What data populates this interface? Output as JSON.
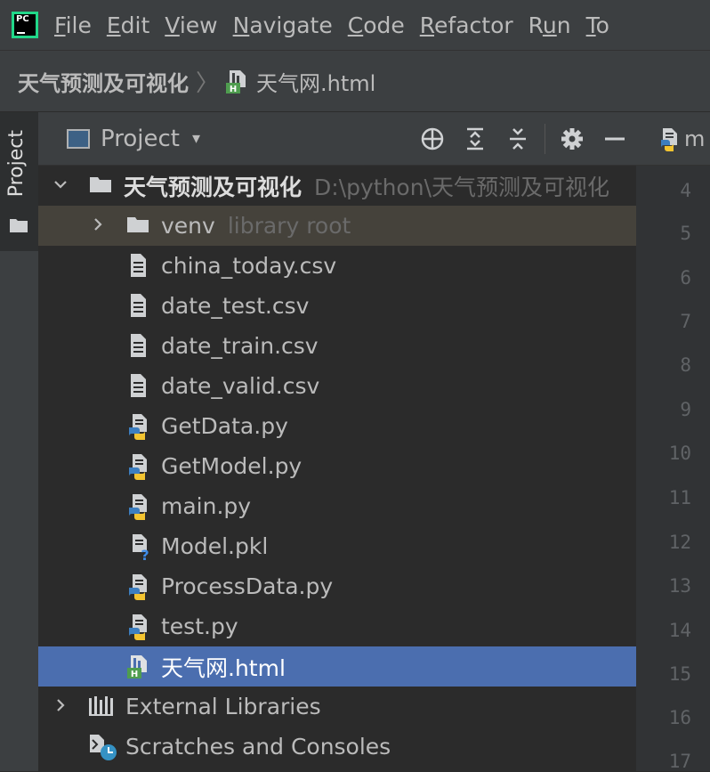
{
  "menubar": {
    "app_icon": "pycharm-logo",
    "items": [
      {
        "mnemonic": "F",
        "rest": "ile"
      },
      {
        "mnemonic": "E",
        "rest": "dit"
      },
      {
        "mnemonic": "V",
        "rest": "iew"
      },
      {
        "mnemonic": "N",
        "rest": "avigate"
      },
      {
        "mnemonic": "C",
        "rest": "ode"
      },
      {
        "mnemonic": "R",
        "rest": "efactor"
      },
      {
        "pre": "R",
        "mnemonic": "u",
        "rest": "n"
      },
      {
        "mnemonic": "T",
        "rest": "o"
      }
    ]
  },
  "breadcrumb": {
    "root": "天气预测及可视化",
    "separator": "〉",
    "file": "天气网.html",
    "file_icon": "html-file-icon"
  },
  "toolstrip": {
    "tab_label": "Project",
    "tab_icon": "folder-icon"
  },
  "project_panel": {
    "title": "Project",
    "caret": "▾",
    "tools": [
      "locate-icon",
      "expand-all-icon",
      "collapse-all-icon",
      "gear-icon",
      "hide-icon"
    ]
  },
  "editor": {
    "tab_label": "m",
    "tab_icon": "python-file-icon",
    "line_numbers": [
      "4",
      "5",
      "6",
      "7",
      "8",
      "9",
      "10",
      "11",
      "12",
      "13",
      "14",
      "15",
      "16",
      "17"
    ]
  },
  "tree": {
    "root": {
      "name": "天气预测及可视化",
      "path": "D:\\python\\天气预测及可视化",
      "icon": "folder-icon",
      "expanded": true
    },
    "venv": {
      "name": "venv",
      "hint": "library root",
      "icon": "folder-icon",
      "expanded": false
    },
    "files": [
      {
        "name": "china_today.csv",
        "icon": "text-file-icon"
      },
      {
        "name": "date_test.csv",
        "icon": "text-file-icon"
      },
      {
        "name": "date_train.csv",
        "icon": "text-file-icon"
      },
      {
        "name": "date_valid.csv",
        "icon": "text-file-icon"
      },
      {
        "name": "GetData.py",
        "icon": "python-file-icon"
      },
      {
        "name": "GetModel.py",
        "icon": "python-file-icon"
      },
      {
        "name": "main.py",
        "icon": "python-file-icon"
      },
      {
        "name": "Model.pkl",
        "icon": "unknown-file-icon"
      },
      {
        "name": "ProcessData.py",
        "icon": "python-file-icon"
      },
      {
        "name": "test.py",
        "icon": "python-file-icon"
      },
      {
        "name": "天气网.html",
        "icon": "html-file-icon",
        "selected": true
      }
    ],
    "external_libraries": {
      "name": "External Libraries",
      "icon": "library-icon"
    },
    "scratches": {
      "name": "Scratches and Consoles",
      "icon": "scratches-icon"
    }
  },
  "colors": {
    "selection": "#4b6eaf",
    "venv_row": "#45423b",
    "panel": "#3c3f41",
    "editor_bg": "#2b2b2b"
  }
}
